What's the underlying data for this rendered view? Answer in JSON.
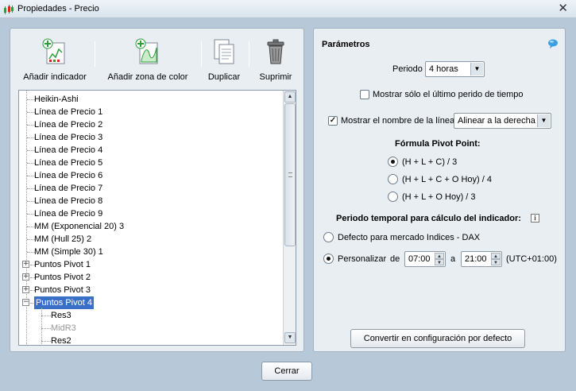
{
  "window": {
    "title": "Propiedades - Precio",
    "close_glyph": "✕"
  },
  "toolbar": {
    "add_indicator": "Añadir indicador",
    "add_color_zone": "Añadir zona de color",
    "duplicate": "Duplicar",
    "delete": "Suprimir"
  },
  "tree": {
    "items": [
      {
        "label": "Heikin-Ashi"
      },
      {
        "label": "Línea de Precio 1"
      },
      {
        "label": "Línea de Precio 2"
      },
      {
        "label": "Línea de Precio 3"
      },
      {
        "label": "Línea de Precio 4"
      },
      {
        "label": "Línea de Precio 5"
      },
      {
        "label": "Línea de Precio 6"
      },
      {
        "label": "Línea de Precio 7"
      },
      {
        "label": "Línea de Precio 8"
      },
      {
        "label": "Línea de Precio 9"
      },
      {
        "label": "MM (Exponencial 20) 3"
      },
      {
        "label": "MM (Hull 25) 2"
      },
      {
        "label": "MM (Simple 30) 1"
      },
      {
        "label": "Puntos Pivot 1",
        "expander": "+"
      },
      {
        "label": "Puntos Pivot 2",
        "expander": "+"
      },
      {
        "label": "Puntos Pivot 3",
        "expander": "+"
      },
      {
        "label": "Puntos Pivot 4",
        "expander": "−",
        "selected": true
      },
      {
        "label": "Res3",
        "child": true
      },
      {
        "label": "MidR3",
        "child": true,
        "disabled": true
      },
      {
        "label": "Res2",
        "child": true
      }
    ]
  },
  "params": {
    "title": "Parámetros",
    "period_label": "Periodo",
    "period_value": "4 horas",
    "show_last_period_label": "Mostrar sólo el último perido de tiempo",
    "show_last_period_checked": false,
    "show_line_name_label": "Mostrar el nombre de la línea",
    "show_line_name_checked": true,
    "align_value": "Alinear a la derecha",
    "formula_title": "Fórmula Pivot Point:",
    "formulas": [
      {
        "label": "(H + L + C) / 3",
        "selected": true
      },
      {
        "label": "(H + L + C + O Hoy) / 4",
        "selected": false
      },
      {
        "label": "(H + L + O Hoy) / 3",
        "selected": false
      }
    ],
    "temporal_title": "Periodo temporal para cálculo del indicador:",
    "info_glyph": "i",
    "default_market_label": "Defecto para mercado Indices - DAX",
    "default_market_selected": false,
    "customize_label": "Personalizar",
    "customize_selected": true,
    "from_label": "de",
    "from_value": "07:00",
    "to_label": "a",
    "to_value": "21:00",
    "timezone": "(UTC+01:00)",
    "convert_default": "Convertir en configuración por defecto"
  },
  "footer": {
    "close_button": "Cerrar"
  },
  "colors": {
    "selection": "#3a6fc7",
    "panel_bg": "#e9eef3",
    "dialog_bg": "#b7c8d8"
  }
}
